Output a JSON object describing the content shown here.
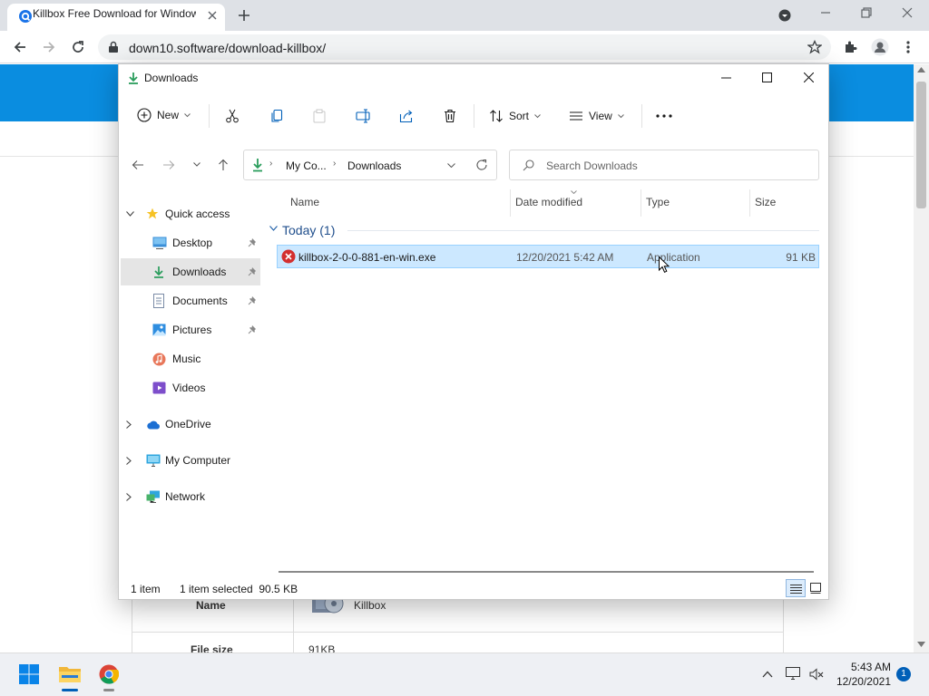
{
  "browser": {
    "tab_title": "Killbox Free Download for Windows",
    "url": "down10.software/download-killbox/"
  },
  "webpage": {
    "table_rows": [
      {
        "label": "Name",
        "value": "Killbox"
      },
      {
        "label": "File size",
        "value": "91KB"
      }
    ]
  },
  "explorer": {
    "title": "Downloads",
    "toolbar": {
      "new_label": "New",
      "sort_label": "Sort",
      "view_label": "View"
    },
    "breadcrumb": [
      "My Co...",
      "Downloads"
    ],
    "search_placeholder": "Search Downloads",
    "nav": {
      "quick_access": "Quick access",
      "items": [
        "Desktop",
        "Downloads",
        "Documents",
        "Pictures",
        "Music",
        "Videos"
      ],
      "onedrive": "OneDrive",
      "my_computer": "My Computer",
      "network": "Network"
    },
    "columns": [
      "Name",
      "Date modified",
      "Type",
      "Size"
    ],
    "group_label": "Today (1)",
    "file": {
      "name": "killbox-2-0-0-881-en-win.exe",
      "date": "12/20/2021 5:42 AM",
      "type": "Application",
      "size": "91 KB"
    },
    "status": {
      "count": "1 item",
      "selection": "1 item selected  90.5 KB"
    }
  },
  "taskbar": {
    "time": "5:43 AM",
    "date": "12/20/2021",
    "notifications": "1"
  },
  "colors": {
    "banner": "#0a8de0",
    "selection": "#cce8ff",
    "accent": "#005fb8"
  }
}
